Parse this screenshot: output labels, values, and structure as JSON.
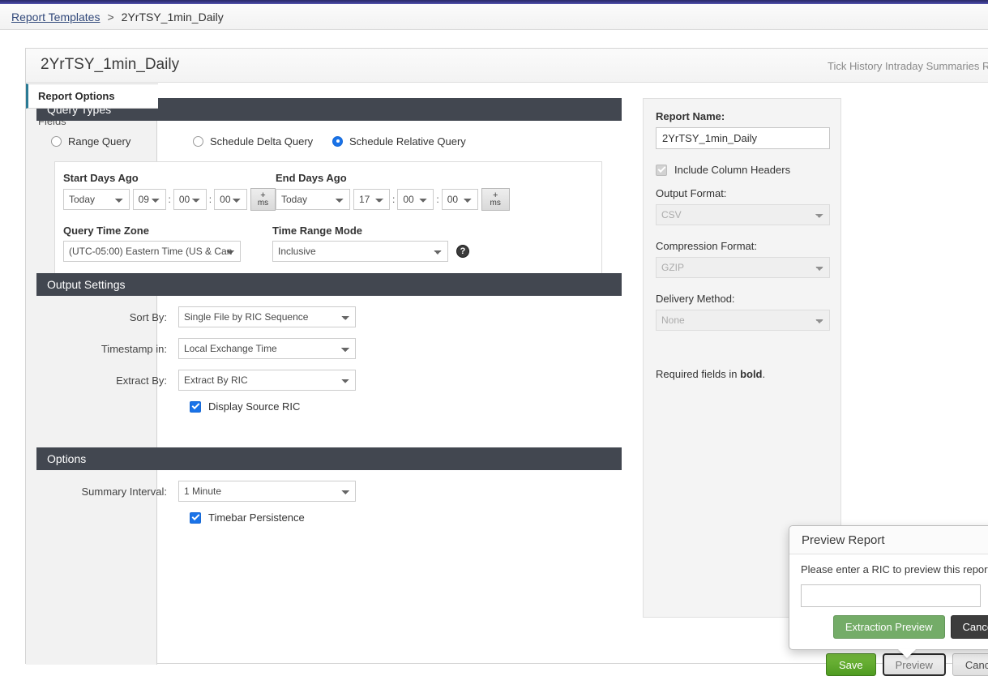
{
  "breadcrumb": {
    "root_label": "Report Templates",
    "separator": ">",
    "current_label": "2YrTSY_1min_Daily"
  },
  "card": {
    "title": "2YrTSY_1min_Daily",
    "subtitle": "Tick History Intraday Summaries Report"
  },
  "tabs": [
    {
      "label": "Report Options"
    },
    {
      "label": "Fields"
    }
  ],
  "query_types": {
    "header": "Query Types",
    "options": [
      {
        "label": "Range Query",
        "selected": false
      },
      {
        "label": "Schedule Delta Query",
        "selected": false
      },
      {
        "label": "Schedule Relative Query",
        "selected": true
      }
    ],
    "start_days_ago": {
      "label": "Start Days Ago",
      "day": "Today",
      "hour": "09",
      "minute": "00",
      "second": "00",
      "ms_button_plus": "+",
      "ms_button_unit": "ms"
    },
    "end_days_ago": {
      "label": "End Days Ago",
      "day": "Today",
      "hour": "17",
      "minute": "00",
      "second": "00",
      "ms_button_plus": "+",
      "ms_button_unit": "ms"
    },
    "query_time_zone": {
      "label": "Query Time Zone",
      "value": "(UTC-05:00) Eastern Time (US & Can"
    },
    "time_range_mode": {
      "label": "Time Range Mode",
      "value": "Inclusive",
      "help_glyph": "?"
    }
  },
  "output_settings": {
    "header": "Output Settings",
    "sort_by": {
      "label": "Sort By:",
      "value": "Single File by RIC Sequence"
    },
    "timestamp_in": {
      "label": "Timestamp in:",
      "value": "Local Exchange Time"
    },
    "extract_by": {
      "label": "Extract By:",
      "value": "Extract By RIC"
    },
    "display_source_ric": {
      "label": "Display Source RIC",
      "checked": true
    }
  },
  "options": {
    "header": "Options",
    "summary_interval": {
      "label": "Summary Interval:",
      "value": "1 Minute"
    },
    "timebar_persistence": {
      "label": "Timebar Persistence",
      "checked": true
    }
  },
  "right_panel": {
    "report_name_label": "Report Name:",
    "report_name_value": "2YrTSY_1min_Daily",
    "include_column_headers_label": "Include Column Headers",
    "output_format_label": "Output Format:",
    "output_format_value": "CSV",
    "compression_format_label": "Compression Format:",
    "compression_format_value": "GZIP",
    "delivery_method_label": "Delivery Method:",
    "delivery_method_value": "None",
    "required_note_prefix": "Required fields in ",
    "required_note_bold": "bold",
    "required_note_suffix": "."
  },
  "preview_popover": {
    "title": "Preview Report",
    "message": "Please enter a RIC to preview this report wi",
    "ric_value": "",
    "extraction_preview_label": "Extraction Preview",
    "cancel_label": "Cancel"
  },
  "bottom_buttons": {
    "save_label": "Save",
    "preview_label": "Preview",
    "cancel_label": "Cancel"
  },
  "colors": {
    "accent_blue": "#1a73e8",
    "section_header": "#424750",
    "save_green": "#5aa72c",
    "extraction_green": "#74ac68",
    "top_bar": "#3b3b8f",
    "active_tab_border": "#2a7a94"
  }
}
